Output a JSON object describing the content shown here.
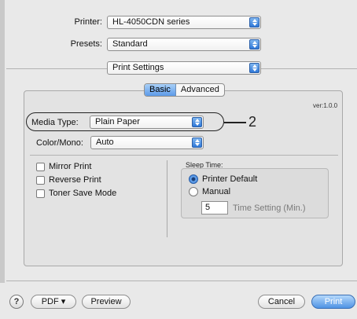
{
  "header": {
    "printer_label": "Printer:",
    "printer_value": "HL-4050CDN series",
    "presets_label": "Presets:",
    "presets_value": "Standard",
    "panel_value": "Print Settings"
  },
  "tabs": [
    {
      "label": "Basic"
    },
    {
      "label": "Advanced"
    }
  ],
  "version": "ver:1.0.0",
  "media_type": {
    "label": "Media Type:",
    "value": "Plain Paper"
  },
  "color_mono": {
    "label": "Color/Mono:",
    "value": "Auto"
  },
  "callout": {
    "number": "2"
  },
  "checkboxes": [
    {
      "label": "Mirror Print",
      "checked": false
    },
    {
      "label": "Reverse Print",
      "checked": false
    },
    {
      "label": "Toner Save Mode",
      "checked": false
    }
  ],
  "sleep_time": {
    "label": "Sleep Time:",
    "options": [
      {
        "label": "Printer Default",
        "selected": true
      },
      {
        "label": "Manual",
        "selected": false
      }
    ],
    "minutes_value": "5",
    "minutes_hint": "Time Setting (Min.)"
  },
  "footer": {
    "help_label": "?",
    "pdf_label": "PDF ▾",
    "preview_label": "Preview",
    "cancel_label": "Cancel",
    "print_label": "Print"
  },
  "colors": {
    "accent": "#3b7fdb",
    "window_bg": "#e9e9e9",
    "group_bg": "#e3e3e3"
  }
}
